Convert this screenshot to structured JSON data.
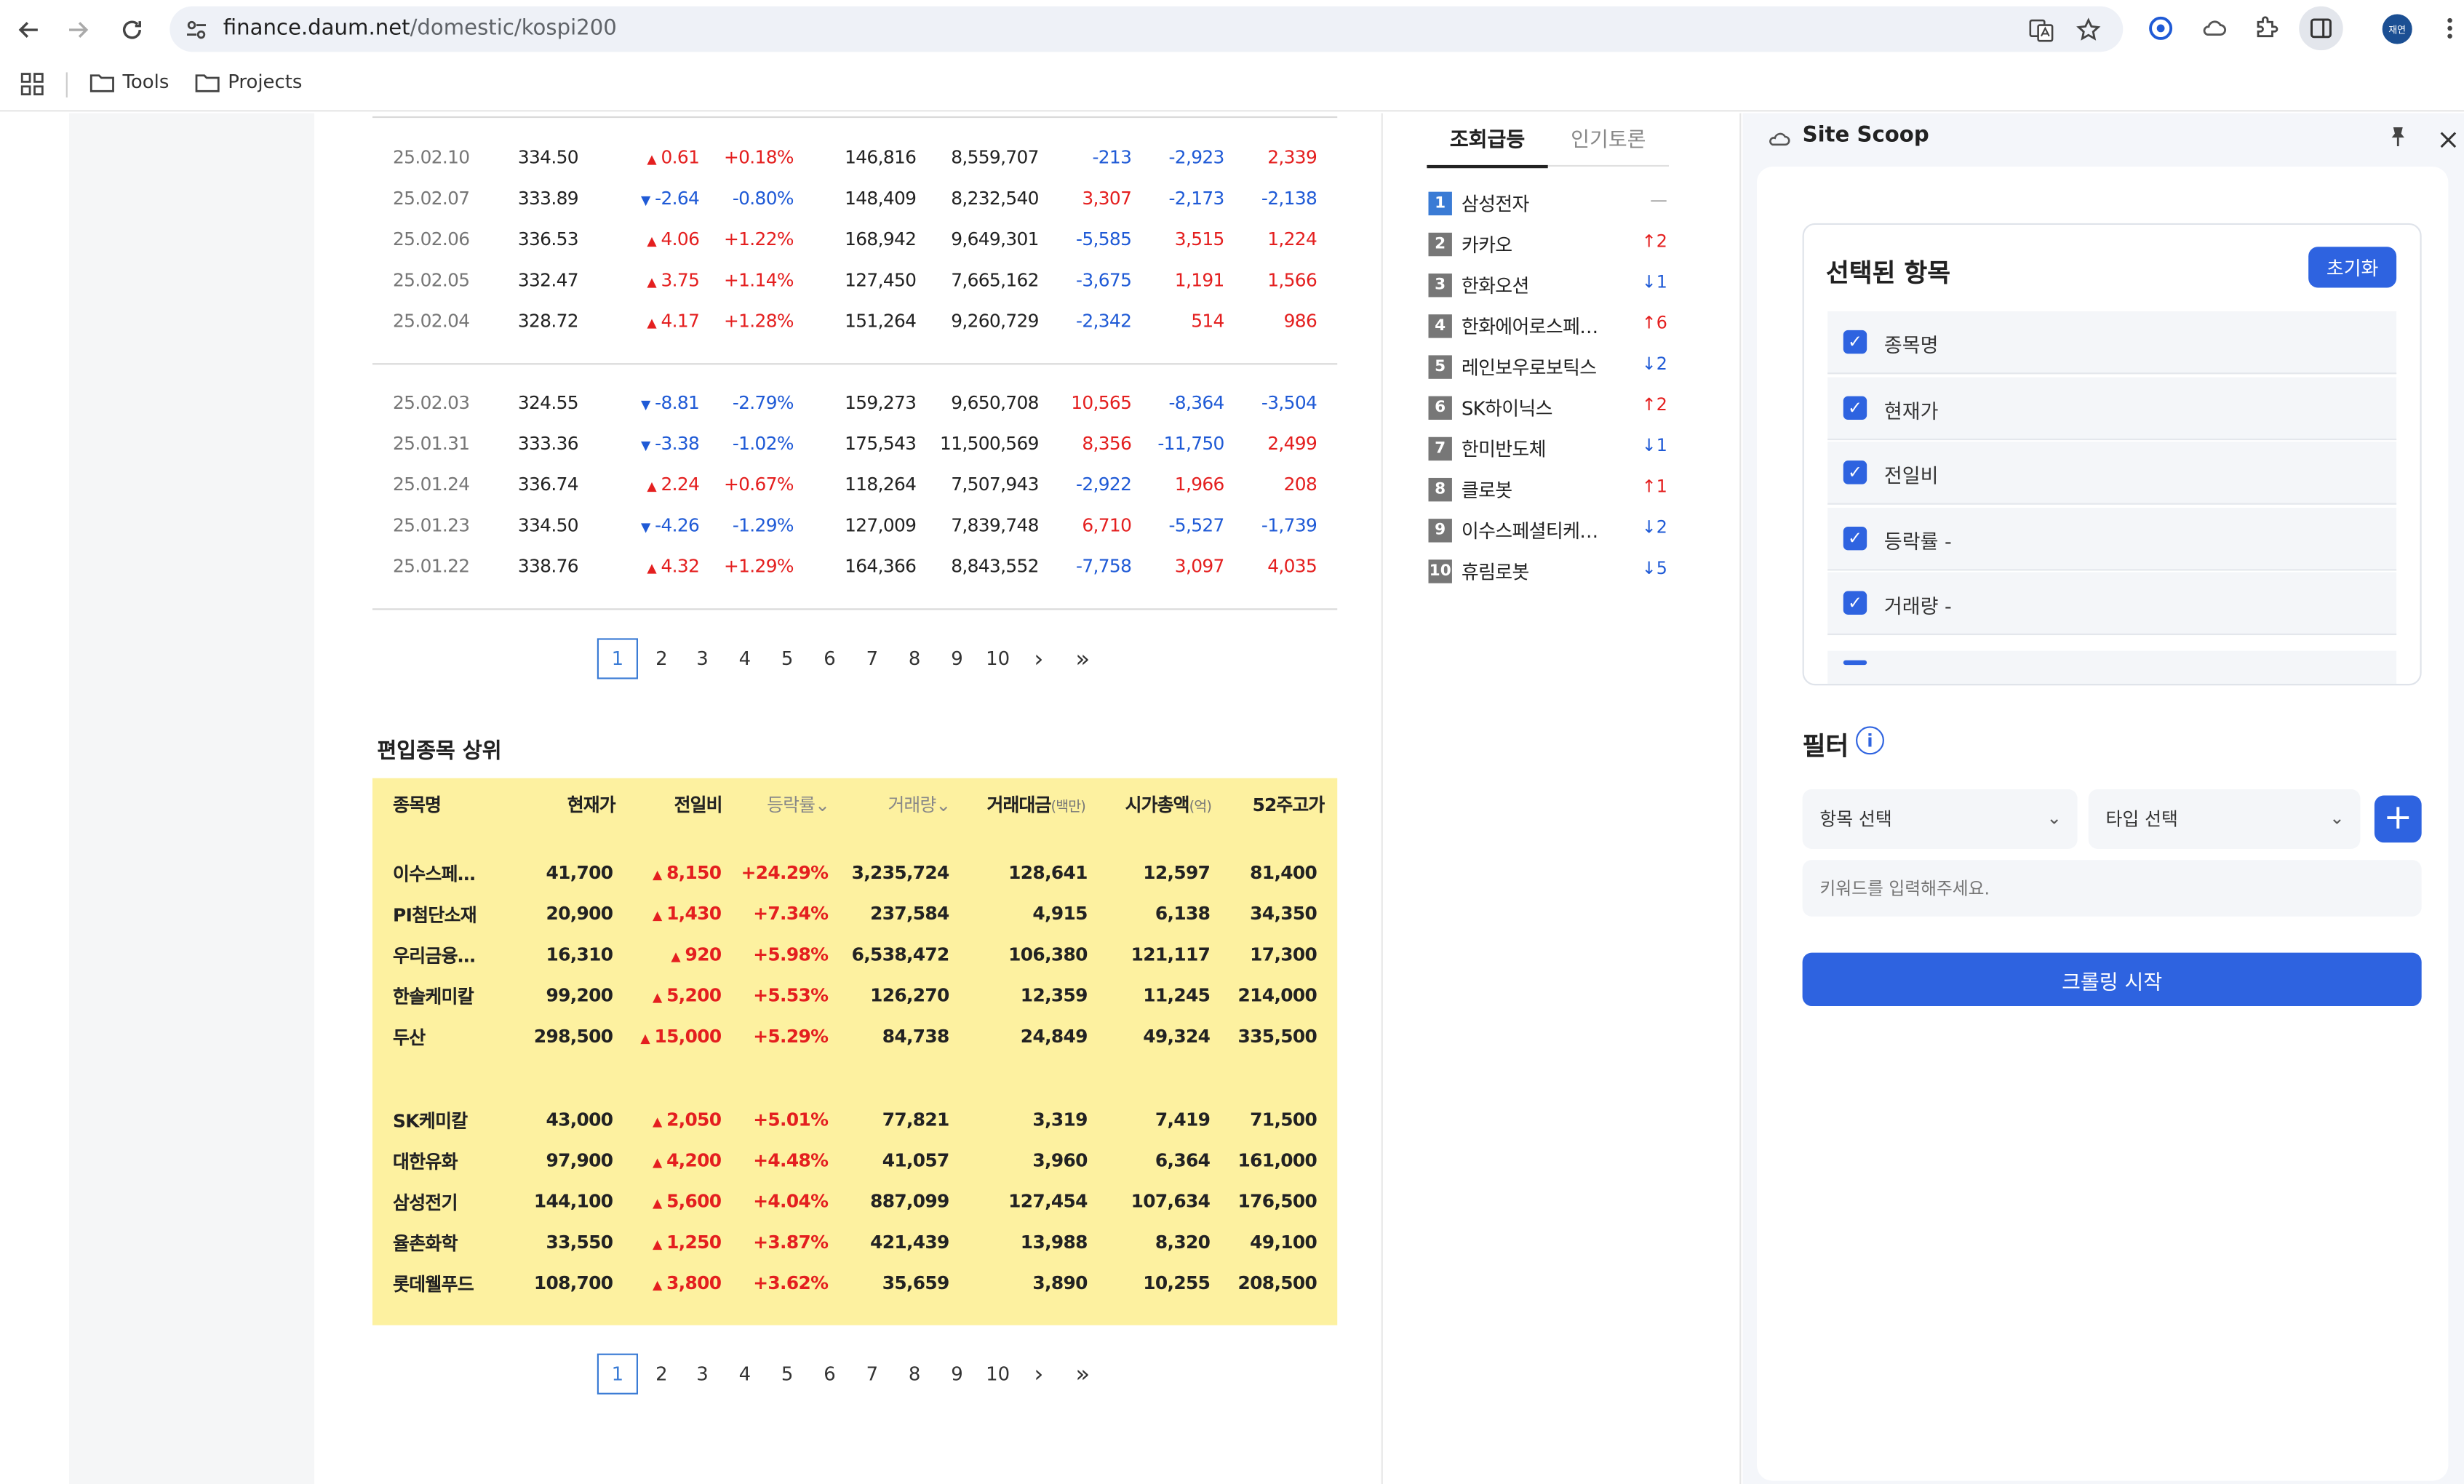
{
  "browser": {
    "url_domain": "finance.daum.net",
    "url_path": "/domestic/kospi200",
    "bookmarks": [
      {
        "label": "Tools"
      },
      {
        "label": "Projects"
      }
    ],
    "profile_initials": "재연"
  },
  "history": {
    "rows": [
      {
        "date": "25.02.10",
        "close": "334.50",
        "dir": "up",
        "chg": "0.61",
        "pct": "+0.18%",
        "vol": "146,816",
        "amt": "8,559,707",
        "ind": "-213",
        "frg": "-2,923",
        "inst": "2,339"
      },
      {
        "date": "25.02.07",
        "close": "333.89",
        "dir": "dn",
        "chg": "-2.64",
        "pct": "-0.80%",
        "vol": "148,409",
        "amt": "8,232,540",
        "ind": "3,307",
        "frg": "-2,173",
        "inst": "-2,138"
      },
      {
        "date": "25.02.06",
        "close": "336.53",
        "dir": "up",
        "chg": "4.06",
        "pct": "+1.22%",
        "vol": "168,942",
        "amt": "9,649,301",
        "ind": "-5,585",
        "frg": "3,515",
        "inst": "1,224"
      },
      {
        "date": "25.02.05",
        "close": "332.47",
        "dir": "up",
        "chg": "3.75",
        "pct": "+1.14%",
        "vol": "127,450",
        "amt": "7,665,162",
        "ind": "-3,675",
        "frg": "1,191",
        "inst": "1,566"
      },
      {
        "date": "25.02.04",
        "close": "328.72",
        "dir": "up",
        "chg": "4.17",
        "pct": "+1.28%",
        "vol": "151,264",
        "amt": "9,260,729",
        "ind": "-2,342",
        "frg": "514",
        "inst": "986"
      },
      {
        "date": "25.02.03",
        "close": "324.55",
        "dir": "dn",
        "chg": "-8.81",
        "pct": "-2.79%",
        "vol": "159,273",
        "amt": "9,650,708",
        "ind": "10,565",
        "frg": "-8,364",
        "inst": "-3,504"
      },
      {
        "date": "25.01.31",
        "close": "333.36",
        "dir": "dn",
        "chg": "-3.38",
        "pct": "-1.02%",
        "vol": "175,543",
        "amt": "11,500,569",
        "ind": "8,356",
        "frg": "-11,750",
        "inst": "2,499"
      },
      {
        "date": "25.01.24",
        "close": "336.74",
        "dir": "up",
        "chg": "2.24",
        "pct": "+0.67%",
        "vol": "118,264",
        "amt": "7,507,943",
        "ind": "-2,922",
        "frg": "1,966",
        "inst": "208"
      },
      {
        "date": "25.01.23",
        "close": "334.50",
        "dir": "dn",
        "chg": "-4.26",
        "pct": "-1.29%",
        "vol": "127,009",
        "amt": "7,839,748",
        "ind": "6,710",
        "frg": "-5,527",
        "inst": "-1,739"
      },
      {
        "date": "25.01.22",
        "close": "338.76",
        "dir": "up",
        "chg": "4.32",
        "pct": "+1.29%",
        "vol": "164,366",
        "amt": "8,843,552",
        "ind": "-7,758",
        "frg": "3,097",
        "inst": "4,035"
      }
    ]
  },
  "pager": {
    "pages": [
      "1",
      "2",
      "3",
      "4",
      "5",
      "6",
      "7",
      "8",
      "9",
      "10"
    ],
    "next": "›",
    "last": "»"
  },
  "top_stocks": {
    "title": "편입종목 상위",
    "headers": {
      "name": "종목명",
      "price": "현재가",
      "change": "전일비",
      "pct": "등락률",
      "volume": "거래량",
      "amount": "거래대금",
      "amount_unit": "(백만)",
      "mcap": "시가총액",
      "mcap_unit": "(억)",
      "high52": "52주고가",
      "sort_glyph": "⌄"
    },
    "rows": [
      {
        "name": "이수스페…",
        "price": "41,700",
        "chg": "8,150",
        "pct": "+24.29%",
        "vol": "3,235,724",
        "amt": "128,641",
        "mcap": "12,597",
        "high": "81,400"
      },
      {
        "name": "PI첨단소재",
        "price": "20,900",
        "chg": "1,430",
        "pct": "+7.34%",
        "vol": "237,584",
        "amt": "4,915",
        "mcap": "6,138",
        "high": "34,350"
      },
      {
        "name": "우리금융…",
        "price": "16,310",
        "chg": "920",
        "pct": "+5.98%",
        "vol": "6,538,472",
        "amt": "106,380",
        "mcap": "121,117",
        "high": "17,300"
      },
      {
        "name": "한솔케미칼",
        "price": "99,200",
        "chg": "5,200",
        "pct": "+5.53%",
        "vol": "126,270",
        "amt": "12,359",
        "mcap": "11,245",
        "high": "214,000"
      },
      {
        "name": "두산",
        "price": "298,500",
        "chg": "15,000",
        "pct": "+5.29%",
        "vol": "84,738",
        "amt": "24,849",
        "mcap": "49,324",
        "high": "335,500"
      },
      {
        "name": "SK케미칼",
        "price": "43,000",
        "chg": "2,050",
        "pct": "+5.01%",
        "vol": "77,821",
        "amt": "3,319",
        "mcap": "7,419",
        "high": "71,500"
      },
      {
        "name": "대한유화",
        "price": "97,900",
        "chg": "4,200",
        "pct": "+4.48%",
        "vol": "41,057",
        "amt": "3,960",
        "mcap": "6,364",
        "high": "161,000"
      },
      {
        "name": "삼성전기",
        "price": "144,100",
        "chg": "5,600",
        "pct": "+4.04%",
        "vol": "887,099",
        "amt": "127,454",
        "mcap": "107,634",
        "high": "176,500"
      },
      {
        "name": "율촌화학",
        "price": "33,550",
        "chg": "1,250",
        "pct": "+3.87%",
        "vol": "421,439",
        "amt": "13,988",
        "mcap": "8,320",
        "high": "49,100"
      },
      {
        "name": "롯데웰푸드",
        "price": "108,700",
        "chg": "3,800",
        "pct": "+3.62%",
        "vol": "35,659",
        "amt": "3,890",
        "mcap": "10,255",
        "high": "208,500"
      }
    ]
  },
  "side": {
    "tabs": [
      "조회급등",
      "인기토론"
    ],
    "ranks": [
      {
        "num": "1",
        "name": "삼성전자",
        "dir": "flat",
        "chg": "—"
      },
      {
        "num": "2",
        "name": "카카오",
        "dir": "up",
        "chg": "↑2"
      },
      {
        "num": "3",
        "name": "한화오션",
        "dir": "dn",
        "chg": "↓1"
      },
      {
        "num": "4",
        "name": "한화에어로스페…",
        "dir": "up",
        "chg": "↑6"
      },
      {
        "num": "5",
        "name": "레인보우로보틱스",
        "dir": "dn",
        "chg": "↓2"
      },
      {
        "num": "6",
        "name": "SK하이닉스",
        "dir": "up",
        "chg": "↑2"
      },
      {
        "num": "7",
        "name": "한미반도체",
        "dir": "dn",
        "chg": "↓1"
      },
      {
        "num": "8",
        "name": "클로봇",
        "dir": "up",
        "chg": "↑1"
      },
      {
        "num": "9",
        "name": "이수스페셜티케…",
        "dir": "dn",
        "chg": "↓2"
      },
      {
        "num": "10",
        "name": "휴림로봇",
        "dir": "dn",
        "chg": "↓5"
      }
    ]
  },
  "extension": {
    "title": "Site Scoop",
    "selected_title": "선택된 항목",
    "reset_label": "초기화",
    "selected_items": [
      "종목명",
      "현재가",
      "전일비",
      "등락률 -",
      "거래량 -"
    ],
    "filter_title": "필터",
    "field_select": "항목 선택",
    "type_select": "타입 선택",
    "keyword_placeholder": "키워드를 입력해주세요.",
    "start_label": "크롤링 시작",
    "check_glyph": "✓",
    "plus_glyph": "+",
    "info_glyph": "i",
    "caret_glyph": "⌄"
  },
  "colors": {
    "up": "#e41f1f",
    "down": "#1f5ad6",
    "accent": "#2e63e0",
    "highlight_bg": "#fdf1a0"
  }
}
